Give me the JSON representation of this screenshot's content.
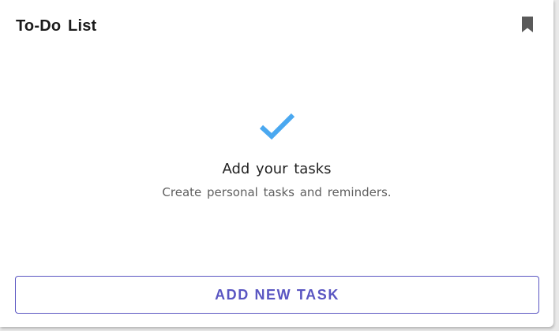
{
  "card": {
    "title": "To-Do List",
    "bookmark_icon": "bookmark-icon"
  },
  "empty_state": {
    "icon": "checkmark-icon",
    "icon_color": "#4aa8f0",
    "title": "Add your tasks",
    "subtitle": "Create personal tasks and reminders."
  },
  "actions": {
    "add_task_label": "ADD NEW TASK",
    "accent_color": "#5a56c2"
  }
}
